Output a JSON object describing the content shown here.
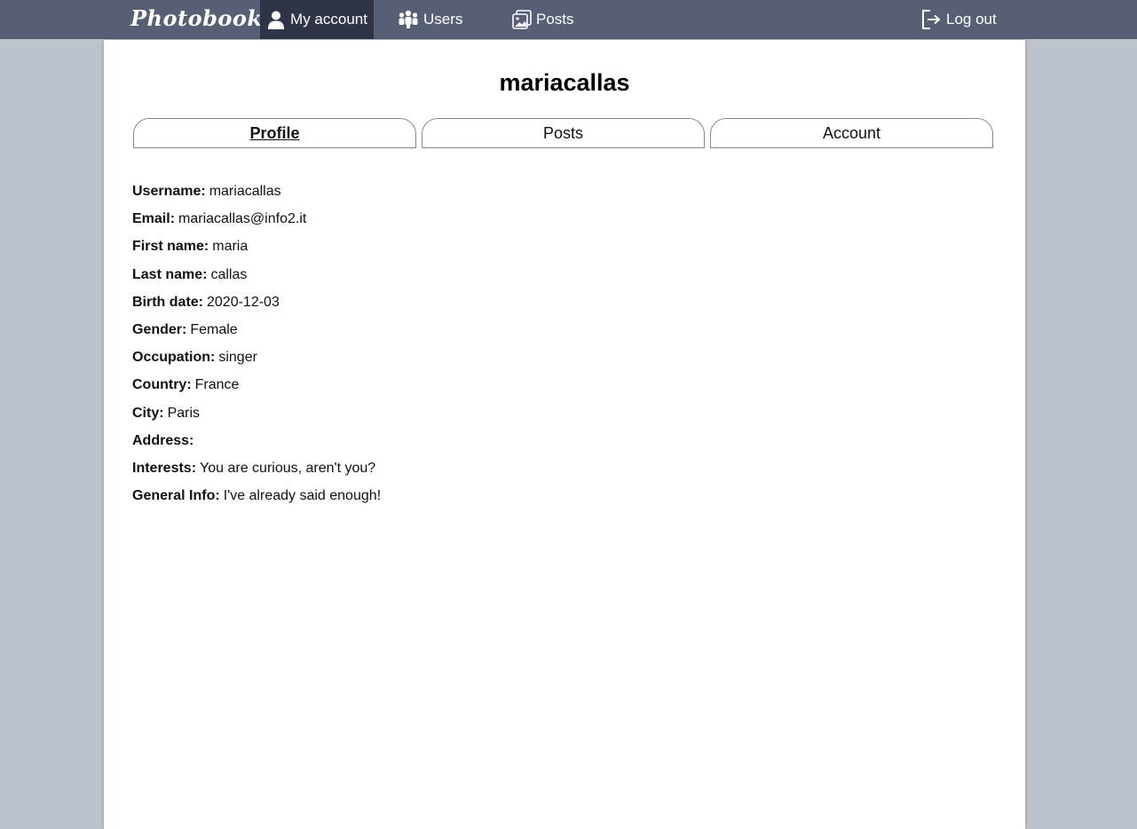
{
  "nav": {
    "brand": "Photobook",
    "my_account": "My account",
    "users": "Users",
    "posts": "Posts",
    "logout": "Log out"
  },
  "profile": {
    "username_title": "mariacallas",
    "tabs": [
      "Profile",
      "Posts",
      "Account"
    ],
    "active_tab": "Profile",
    "fields": [
      {
        "label": "Username:",
        "value": "mariacallas"
      },
      {
        "label": "Email:",
        "value": "mariacallas@info2.it"
      },
      {
        "label": "First name:",
        "value": "maria"
      },
      {
        "label": "Last name:",
        "value": "callas"
      },
      {
        "label": "Birth date:",
        "value": "2020-12-03"
      },
      {
        "label": "Gender:",
        "value": "Female"
      },
      {
        "label": "Occupation:",
        "value": "singer"
      },
      {
        "label": "Country:",
        "value": "France"
      },
      {
        "label": "City:",
        "value": "Paris"
      },
      {
        "label": "Address:",
        "value": ""
      },
      {
        "label": "Interests:",
        "value": "You are curious, aren't you?"
      },
      {
        "label": "General Info:",
        "value": "I've already said enough!"
      }
    ]
  },
  "colors": {
    "navbar": "#575f75",
    "navbar_active": "#2f3446",
    "background": "#bcc3cb",
    "panel": "#ffffff"
  }
}
